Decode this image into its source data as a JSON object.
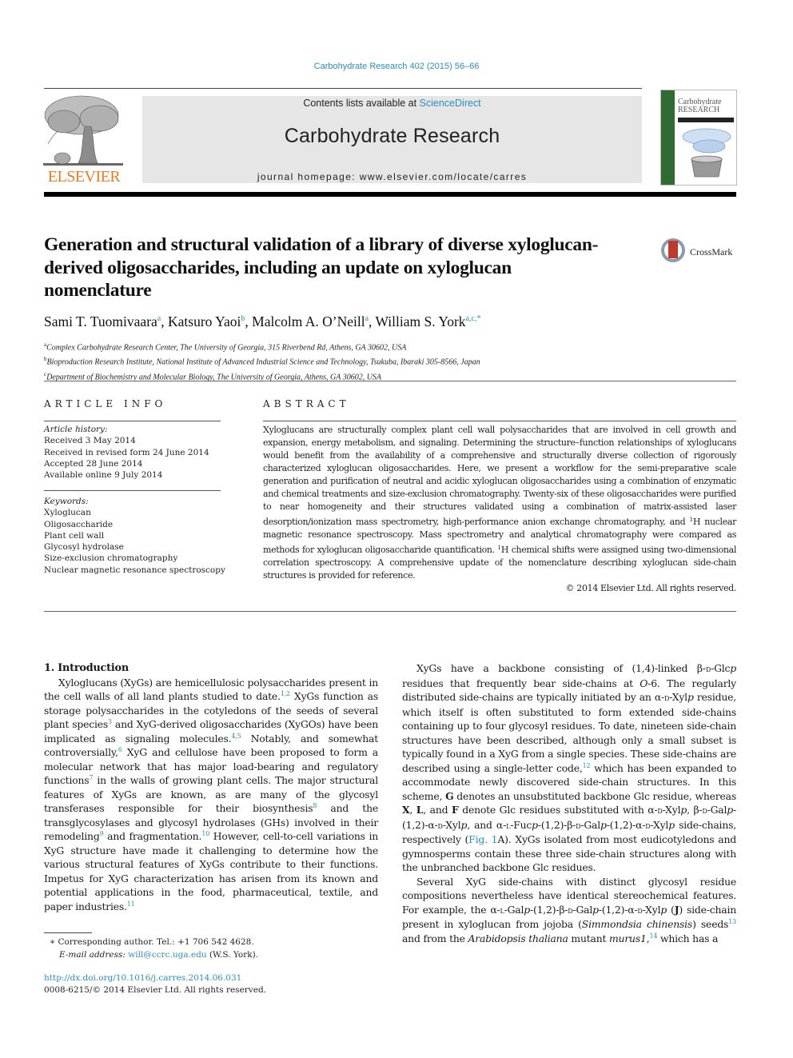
{
  "header": {
    "citation": "Carbohydrate Research 402 (2015) 56–66",
    "publisher_logo_text": "ELSEVIER",
    "contents_prefix": "Contents lists available at ",
    "contents_link": "ScienceDirect",
    "journal_name": "Carbohydrate Research",
    "homepage_prefix": "journal homepage: ",
    "homepage_url": "www.elsevier.com/locate/carres",
    "cover_title_1": "Carbohydrate",
    "cover_title_2": "RESEARCH",
    "brand_color": "#f07a22",
    "link_color": "#2a8fbd"
  },
  "article": {
    "title": "Generation and structural validation of a library of diverse xyloglucan-derived oligosaccharides, including an update on xyloglucan nomenclature",
    "crossmark_label": "CrossMark",
    "authors": [
      {
        "name": "Sami T. Tuomivaara",
        "aff": "a"
      },
      {
        "name": "Katsuro Yaoi",
        "aff": "b"
      },
      {
        "name": "Malcolm A. O’Neill",
        "aff": "a"
      },
      {
        "name": "William S. York",
        "aff": "a,c,*"
      }
    ],
    "affiliations": [
      {
        "key": "a",
        "text": "Complex Carbohydrate Research Center, The University of Georgia, 315 Riverbend Rd, Athens, GA 30602, USA"
      },
      {
        "key": "b",
        "text": "Bioproduction Research Institute, National Institute of Advanced Industrial Science and Technology, Tsukuba, Ibaraki 305-8566, Japan"
      },
      {
        "key": "c",
        "text": "Department of Biochemistry and Molecular Biology, The University of Georgia, Athens, GA 30602, USA"
      }
    ]
  },
  "article_info": {
    "heading": "ARTICLE INFO",
    "history_label": "Article history:",
    "history": [
      "Received 3 May 2014",
      "Received in revised form 24 June 2014",
      "Accepted 28 June 2014",
      "Available online 9 July 2014"
    ],
    "keywords_label": "Keywords:",
    "keywords": [
      "Xyloglucan",
      "Oligosaccharide",
      "Plant cell wall",
      "Glycosyl hydrolase",
      "Size-exclusion chromatography",
      "Nuclear magnetic resonance spectroscopy"
    ]
  },
  "abstract": {
    "heading": "ABSTRACT",
    "part1": "Xyloglucans are structurally complex plant cell wall polysaccharides that are involved in cell growth and expansion, energy metabolism, and signaling. Determining the structure–function relationships of xyloglucans would benefit from the availability of a comprehensive and structurally diverse collection of rigorously characterized xyloglucan oligosaccharides. Here, we present a workflow for the semi-preparative scale generation and purification of neutral and acidic xyloglucan oligosaccharides using a combination of enzymatic and chemical treatments and size-exclusion chromatography. Twenty-six of these oligosaccharides were purified to near homogeneity and their structures validated using a combination of matrix-assisted laser desorption/ionization mass spectrometry, high-performance anion exchange chromatography, and ",
    "sup1": "1",
    "part2": "H nuclear magnetic resonance spectroscopy. Mass spectrometry and analytical chromatography were compared as methods for xyloglucan oligosaccharide quantification. ",
    "sup2": "1",
    "part3": "H chemical shifts were assigned using two-dimensional correlation spectroscopy. A comprehensive update of the nomenclature describing xyloglucan side-chain structures is provided for reference.",
    "copyright": "© 2014 Elsevier Ltd. All rights reserved."
  },
  "body": {
    "intro_heading": "1. Introduction",
    "left_p1": [
      {
        "t": "Xyloglucans (XyGs) are hemicellulosic polysaccharides present in the cell walls of all land plants studied to date."
      },
      {
        "sup": "1,2"
      },
      {
        "t": " XyGs function as storage polysaccharides in the cotyledons of the seeds of several plant species"
      },
      {
        "sup": "3"
      },
      {
        "t": " and XyG-derived oligosaccharides (XyGOs) have been implicated as signaling molecules."
      },
      {
        "sup": "4,5"
      },
      {
        "t": " Notably, and somewhat controversially,"
      },
      {
        "sup": "6"
      },
      {
        "t": " XyG and cellulose have been proposed to form a molecular network that has major load-bearing and regulatory functions"
      },
      {
        "sup": "7"
      },
      {
        "t": " in the walls of growing plant cells. The major structural features of XyGs are known, as are many of the glycosyl transferases responsible for their biosynthesis"
      },
      {
        "sup": "8"
      },
      {
        "t": " and the transglycosylases and glycosyl hydrolases (GHs) involved in their remodeling"
      },
      {
        "sup": "9"
      },
      {
        "t": " and fragmentation."
      },
      {
        "sup": "10"
      },
      {
        "t": " However, cell-to-cell variations in XyG structure have made it challenging to determine how the various structural features of XyGs contribute to their functions. Impetus for XyG characterization has arisen from its known and potential applications in the food, pharmaceutical, textile, and paper industries."
      },
      {
        "sup": "11"
      }
    ],
    "right_p1": [
      {
        "t": "XyGs have a backbone consisting of (1,4)-linked β-"
      },
      {
        "sc": "d"
      },
      {
        "t": "-Glc"
      },
      {
        "i": "p"
      },
      {
        "t": " residues that frequently bear side-chains at "
      },
      {
        "i": "O"
      },
      {
        "t": "-6. The regularly distributed side-chains are typically initiated by an α-"
      },
      {
        "sc": "d"
      },
      {
        "t": "-Xyl"
      },
      {
        "i": "p"
      },
      {
        "t": " residue, which itself is often substituted to form extended side-chains containing up to four glycosyl residues. To date, nineteen side-chain structures have been described, although only a small subset is typically found in a XyG from a single species. These side-chains are described using a single-letter code,"
      },
      {
        "sup": "12"
      },
      {
        "t": " which has been expanded to accommodate newly discovered side-chain structures. In this scheme, "
      },
      {
        "b": "G"
      },
      {
        "t": " denotes an unsubstituted backbone Glc residue, whereas "
      },
      {
        "b": "X"
      },
      {
        "t": ", "
      },
      {
        "b": "L"
      },
      {
        "t": ", and "
      },
      {
        "b": "F"
      },
      {
        "t": " denote Glc residues substituted with α-"
      },
      {
        "sc": "d"
      },
      {
        "t": "-Xyl"
      },
      {
        "i": "p"
      },
      {
        "t": ", β-"
      },
      {
        "sc": "d"
      },
      {
        "t": "-Gal"
      },
      {
        "i": "p"
      },
      {
        "t": "-(1,2)-α-"
      },
      {
        "sc": "d"
      },
      {
        "t": "-Xyl"
      },
      {
        "i": "p"
      },
      {
        "t": ", and α-"
      },
      {
        "sc": "l"
      },
      {
        "t": "-Fuc"
      },
      {
        "i": "p"
      },
      {
        "t": "-(1,2)-β-"
      },
      {
        "sc": "d"
      },
      {
        "t": "-Gal"
      },
      {
        "i": "p"
      },
      {
        "t": "-(1,2)-α-"
      },
      {
        "sc": "d"
      },
      {
        "t": "-Xyl"
      },
      {
        "i": "p"
      },
      {
        "t": " side-chains, respectively ("
      },
      {
        "link": "Fig. 1"
      },
      {
        "t": "A). XyGs isolated from most eudicotyledons and gymnosperms contain these three side-chain structures along with the unbranched backbone Glc residues."
      }
    ],
    "right_p2": [
      {
        "t": "Several XyG side-chains with distinct glycosyl residue compositions nevertheless have identical stereochemical features. For example, the α-"
      },
      {
        "sc": "l"
      },
      {
        "t": "-Gal"
      },
      {
        "i": "p"
      },
      {
        "t": "-(1,2)-β-"
      },
      {
        "sc": "d"
      },
      {
        "t": "-Gal"
      },
      {
        "i": "p"
      },
      {
        "t": "-(1,2)-α-"
      },
      {
        "sc": "d"
      },
      {
        "t": "-Xyl"
      },
      {
        "i": "p"
      },
      {
        "t": " ("
      },
      {
        "b": "J"
      },
      {
        "t": ") side-chain present in xyloglucan from jojoba ("
      },
      {
        "i": "Simmondsia chinensis"
      },
      {
        "t": ") seeds"
      },
      {
        "sup": "13"
      },
      {
        "t": " and from the "
      },
      {
        "i": "Arabidopsis thaliana"
      },
      {
        "t": " mutant "
      },
      {
        "i": "murus1"
      },
      {
        "t": ","
      },
      {
        "sup": "14"
      },
      {
        "t": " which has a"
      }
    ]
  },
  "footnotes": {
    "corresponding": "∗ Corresponding author. Tel.: +1 706 542 4628.",
    "email_label": "E-mail address:",
    "email": "will@ccrc.uga.edu",
    "email_suffix": " (W.S. York).",
    "doi": "http://dx.doi.org/10.1016/j.carres.2014.06.031",
    "issn": "0008-6215/© 2014 Elsevier Ltd. All rights reserved."
  }
}
